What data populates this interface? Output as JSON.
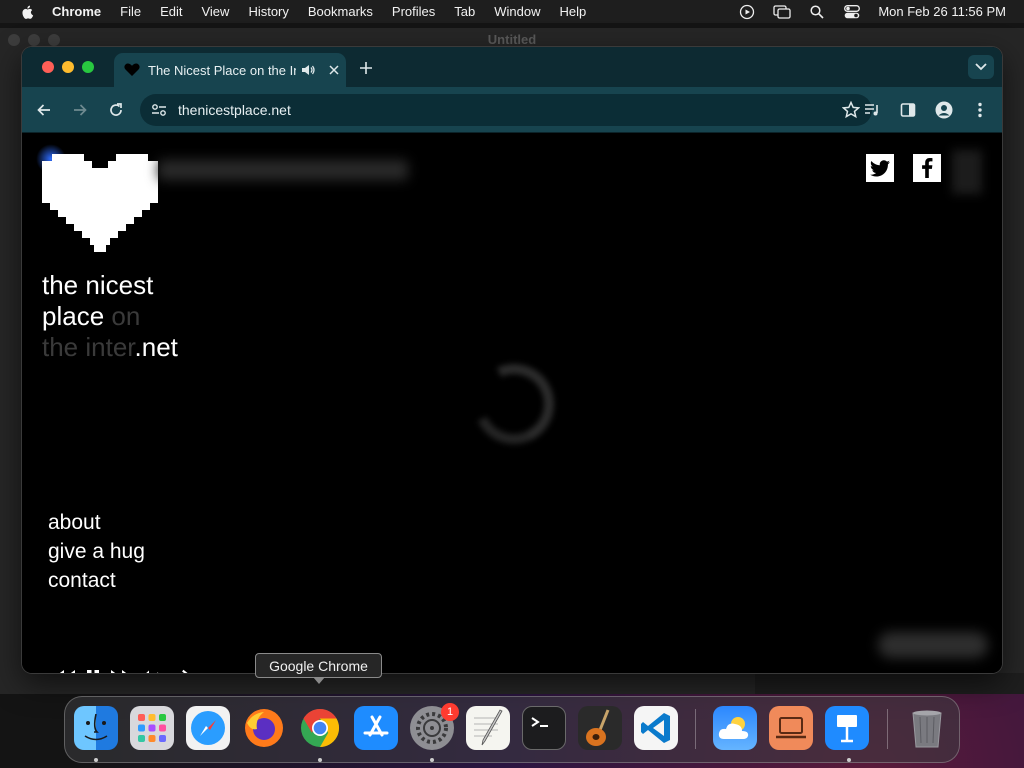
{
  "menubar": {
    "app_name": "Chrome",
    "items": [
      "File",
      "Edit",
      "View",
      "History",
      "Bookmarks",
      "Profiles",
      "Tab",
      "Window",
      "Help"
    ],
    "clock": "Mon Feb 26  11:56 PM"
  },
  "background_window": {
    "title": "Untitled"
  },
  "browser": {
    "tab": {
      "title": "The Nicest Place on the Internet"
    },
    "omnibox": {
      "url": "thenicestplace.net"
    }
  },
  "page": {
    "brand": {
      "line1": "the nicest",
      "line2_bright": "place",
      "line2_dim": " on",
      "line3_dim": "the inter",
      "line3_bright": ".net"
    },
    "nav": [
      "about",
      "give a hug",
      "contact"
    ]
  },
  "tooltip": {
    "text": "Google Chrome"
  },
  "dock": {
    "apps": [
      {
        "name": "Finder",
        "icon": "finder-icon"
      },
      {
        "name": "Launchpad",
        "icon": "launchpad-icon"
      },
      {
        "name": "Safari",
        "icon": "safari-icon"
      },
      {
        "name": "Firefox",
        "icon": "firefox-icon"
      },
      {
        "name": "Google Chrome",
        "icon": "chrome-icon"
      },
      {
        "name": "App Store",
        "icon": "app-store-icon"
      },
      {
        "name": "System Settings",
        "icon": "settings-icon",
        "badge": "1"
      },
      {
        "name": "TextEdit",
        "icon": "textedit-icon"
      },
      {
        "name": "Terminal",
        "icon": "terminal-icon"
      },
      {
        "name": "GarageBand",
        "icon": "garageband-icon"
      },
      {
        "name": "Visual Studio Code",
        "icon": "vscode-icon"
      },
      {
        "name": "Weather",
        "icon": "weather-icon"
      },
      {
        "name": "Preview",
        "icon": "laptop-icon"
      },
      {
        "name": "Keynote",
        "icon": "keynote-icon"
      },
      {
        "name": "Trash",
        "icon": "trash-icon"
      }
    ],
    "settings_badge": "1"
  },
  "colors": {
    "tab_strip": "#0d2a32",
    "toolbar": "#17444f",
    "omnibox": "#0b2d36",
    "page_bg": "#000000",
    "brand_dim": "#3a3a3a"
  }
}
